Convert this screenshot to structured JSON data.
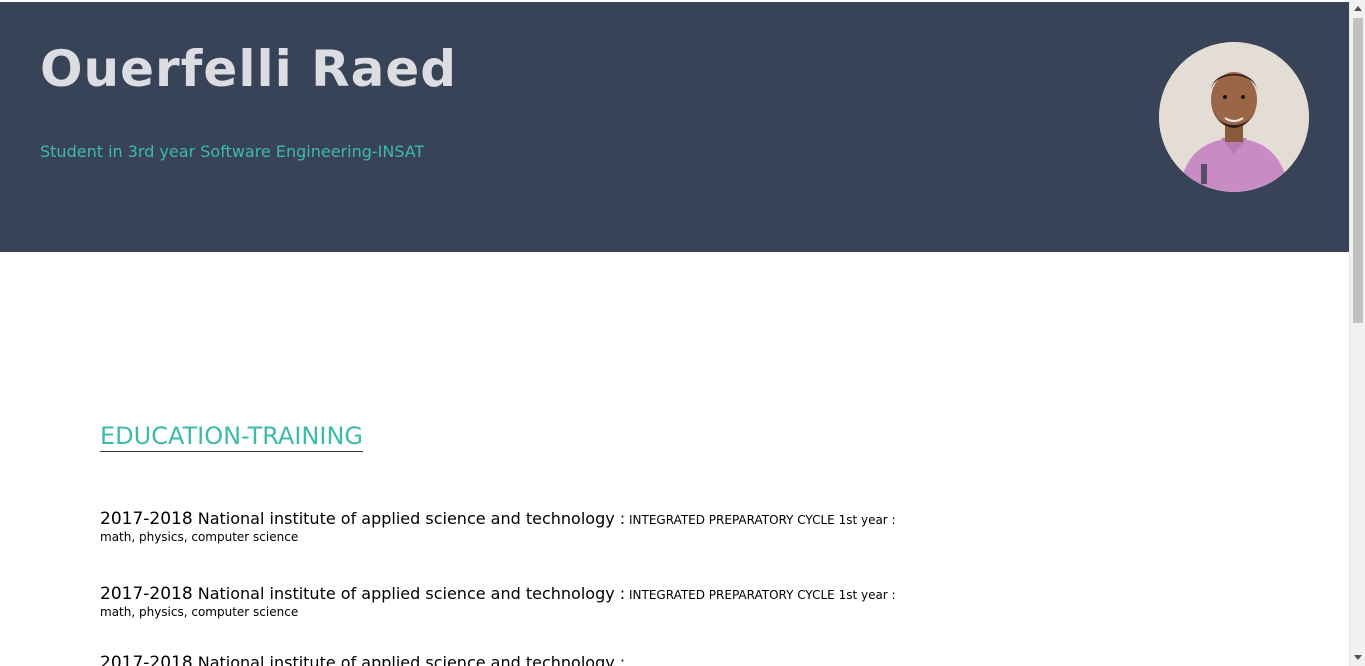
{
  "header": {
    "name": "Ouerfelli Raed",
    "subtitle": "Student in 3rd year Software Engineering-INSAT"
  },
  "colors": {
    "header_bg": "#384357",
    "accent": "#3cbba8",
    "name_text": "#dcdde2"
  },
  "education": {
    "title": "EDUCATION-TRAINING",
    "entries": [
      {
        "year": "2017-2018",
        "institution": " National institute of applied science and technology :",
        "detail": " INTEGRATED PREPARATORY CYCLE 1st year :",
        "subjects": "math, physics, computer science"
      },
      {
        "year": "2017-2018",
        "institution": " National institute of applied science and technology :",
        "detail": " INTEGRATED PREPARATORY CYCLE 1st year :",
        "subjects": "math, physics, computer science"
      },
      {
        "year": "2017-2018",
        "institution": " National institute of applied science and technology :",
        "detail": "",
        "subjects": ""
      }
    ]
  }
}
